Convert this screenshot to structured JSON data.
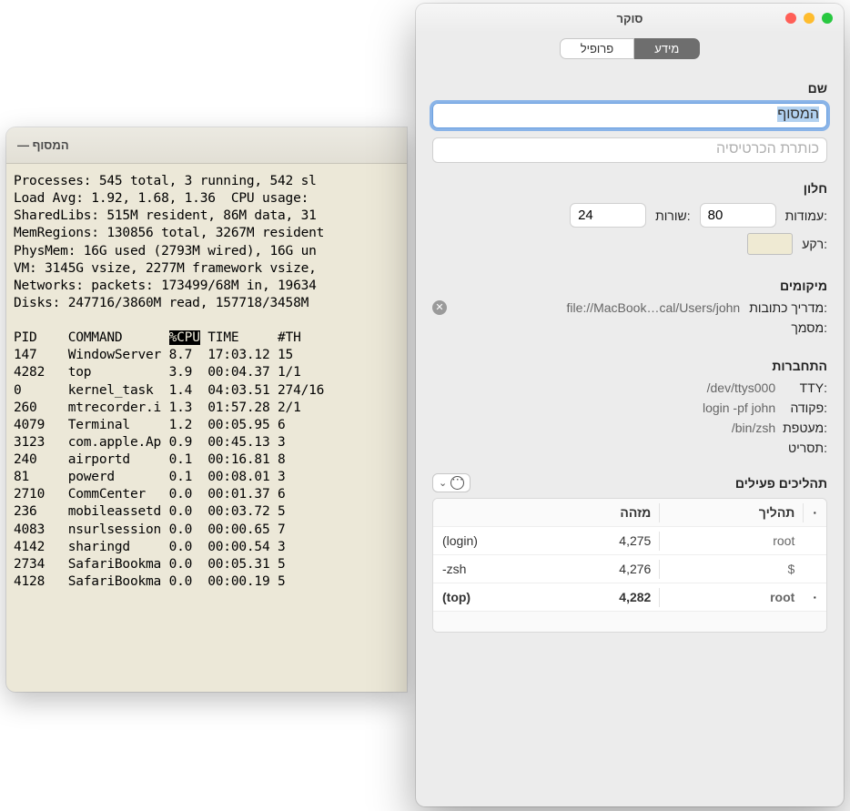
{
  "terminal": {
    "title": "המסוף —",
    "lines_top": [
      "Processes: 545 total, 3 running, 542 sl",
      "Load Avg: 1.92, 1.68, 1.36  CPU usage:",
      "SharedLibs: 515M resident, 86M data, 31",
      "MemRegions: 130856 total, 3267M resident",
      "PhysMem: 16G used (2793M wired), 16G un",
      "VM: 3145G vsize, 2277M framework vsize,",
      "Networks: packets: 173499/68M in, 19634",
      "Disks: 247716/3860M read, 157718/3458M "
    ],
    "header": {
      "pid": "PID",
      "command": "COMMAND",
      "cpu": "%CPU",
      "time": "TIME",
      "th": "#TH"
    },
    "rows": [
      {
        "pid": "147",
        "cmd": "WindowServer",
        "cpu": "8.7",
        "time": "17:03.12",
        "th": "15"
      },
      {
        "pid": "4282",
        "cmd": "top",
        "cpu": "3.9",
        "time": "00:04.37",
        "th": "1/1"
      },
      {
        "pid": "0",
        "cmd": "kernel_task",
        "cpu": "1.4",
        "time": "04:03.51",
        "th": "274/16"
      },
      {
        "pid": "260",
        "cmd": "mtrecorder.i",
        "cpu": "1.3",
        "time": "01:57.28",
        "th": "2/1"
      },
      {
        "pid": "4079",
        "cmd": "Terminal",
        "cpu": "1.2",
        "time": "00:05.95",
        "th": "6"
      },
      {
        "pid": "3123",
        "cmd": "com.apple.Ap",
        "cpu": "0.9",
        "time": "00:45.13",
        "th": "3"
      },
      {
        "pid": "240",
        "cmd": "airportd",
        "cpu": "0.1",
        "time": "00:16.81",
        "th": "8"
      },
      {
        "pid": "81",
        "cmd": "powerd",
        "cpu": "0.1",
        "time": "00:08.01",
        "th": "3"
      },
      {
        "pid": "2710",
        "cmd": "CommCenter",
        "cpu": "0.0",
        "time": "00:01.37",
        "th": "6"
      },
      {
        "pid": "236",
        "cmd": "mobileassetd",
        "cpu": "0.0",
        "time": "00:03.72",
        "th": "5"
      },
      {
        "pid": "4083",
        "cmd": "nsurlsession",
        "cpu": "0.0",
        "time": "00:00.65",
        "th": "7"
      },
      {
        "pid": "4142",
        "cmd": "sharingd",
        "cpu": "0.0",
        "time": "00:00.54",
        "th": "3"
      },
      {
        "pid": "2734",
        "cmd": "SafariBookma",
        "cpu": "0.0",
        "time": "00:05.31",
        "th": "5"
      },
      {
        "pid": "4128",
        "cmd": "SafariBookma",
        "cpu": "0.0",
        "time": "00:00.19",
        "th": "5"
      }
    ]
  },
  "inspector": {
    "title": "סוקר",
    "tabs": {
      "info": "מידע",
      "profile": "פרופיל"
    },
    "name_section": {
      "label": "שם",
      "value": "המסוף",
      "subtitle_placeholder": "כותרת הכרטיסיה"
    },
    "window_section": {
      "label": "חלון",
      "columns_label": ":עמודות",
      "columns_value": "80",
      "rows_label": ":שורות",
      "rows_value": "24",
      "bg_label": ":רקע"
    },
    "locations_section": {
      "label": "מיקומים",
      "addressdir_label": ":מדריך כתובות",
      "addressdir_value": "file://MacBook…cal/Users/john",
      "doc_label": ":מסמך"
    },
    "connection_section": {
      "label": "התחברות",
      "tty_label": ":TTY",
      "tty_value": "/dev/ttys000",
      "command_label": ":פקודה",
      "command_value": "login -pf john",
      "shell_label": ":מעטפת",
      "shell_value": "/bin/zsh",
      "script_label": ":תסריט"
    },
    "processes_section": {
      "label": "תהליכים פעילים",
      "col_bullet": "·",
      "col_process": "תהליך",
      "col_id": "מזהה",
      "rows": [
        {
          "bullet": "",
          "proc": "root",
          "cmd": "(login)",
          "id": "4,275"
        },
        {
          "bullet": "",
          "proc": "$",
          "cmd": "-zsh",
          "id": "4,276"
        },
        {
          "bullet": "·",
          "proc": "root",
          "cmd": "(top)",
          "id": "4,282",
          "bold": true
        }
      ]
    }
  }
}
